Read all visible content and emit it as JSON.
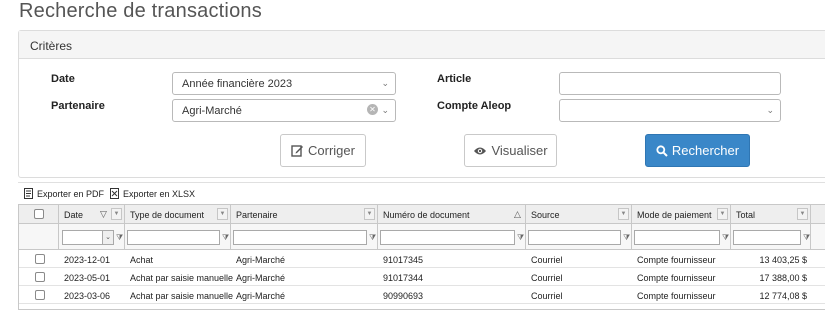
{
  "page": {
    "title": "Recherche de transactions"
  },
  "criteria": {
    "header": "Critères",
    "date_label": "Date",
    "date_value": "Année financière 2023",
    "partner_label": "Partenaire",
    "partner_value": "Agri-Marché",
    "article_label": "Article",
    "article_value": "",
    "account_label": "Compte Aleop",
    "account_value": "",
    "btn_reset": "Corriger",
    "btn_view": "Visualiser",
    "btn_search": "Rechercher"
  },
  "toolbar": {
    "export_pdf": "Exporter en PDF",
    "export_xlsx": "Exporter en XLSX"
  },
  "grid": {
    "columns": [
      "Date",
      "Type de document",
      "Partenaire",
      "Numéro de document",
      "Source",
      "Mode de paiement",
      "Total"
    ],
    "rows": [
      {
        "date": "2023-12-01",
        "type": "Achat",
        "partner": "Agri-Marché",
        "docnum": "91017345",
        "source": "Courriel",
        "payment": "Compte fournisseur",
        "total": "13 403,25 $"
      },
      {
        "date": "2023-05-01",
        "type": "Achat par saisie manuelle",
        "partner": "Agri-Marché",
        "docnum": "91017344",
        "source": "Courriel",
        "payment": "Compte fournisseur",
        "total": "17 388,00 $"
      },
      {
        "date": "2023-03-06",
        "type": "Achat par saisie manuelle",
        "partner": "Agri-Marché",
        "docnum": "90990693",
        "source": "Courriel",
        "payment": "Compte fournisseur",
        "total": "12 774,08 $"
      }
    ]
  },
  "icons": {
    "reset": "edit-icon",
    "view": "eye-icon",
    "search": "search-icon",
    "pdf": "pdf-file-icon",
    "xlsx": "excel-file-icon"
  },
  "colors": {
    "primary": "#3a87c8"
  }
}
